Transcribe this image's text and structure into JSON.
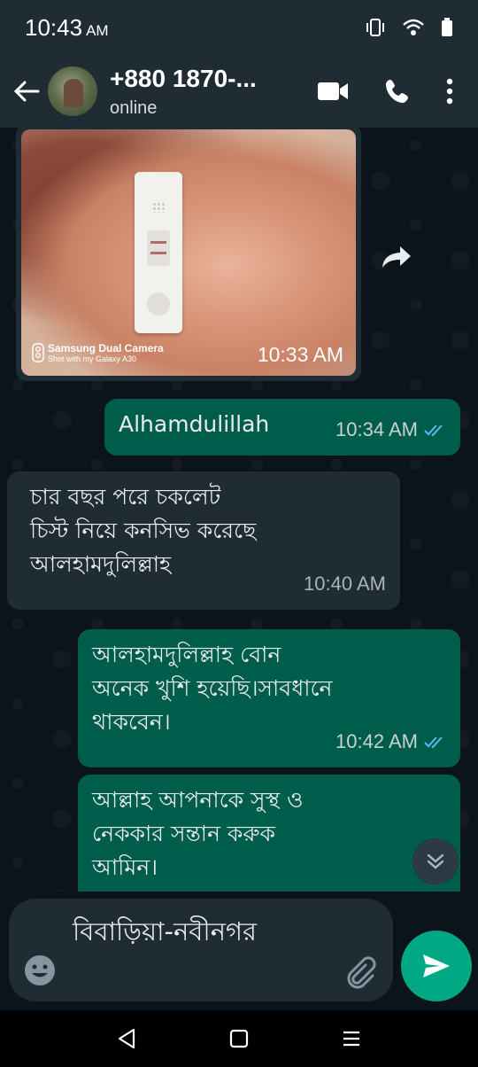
{
  "status_bar": {
    "time": "10:43",
    "ampm": "AM"
  },
  "header": {
    "contact_name": "+880 1870-...",
    "contact_status": "online"
  },
  "messages": {
    "image": {
      "camera_label": "Samsung Dual Camera",
      "camera_sub": "Shot with my Galaxy A30",
      "time": "10:33 AM"
    },
    "m1": {
      "text": "Alhamdulillah",
      "time": "10:34 AM"
    },
    "m2": {
      "line1": "চার বছর পরে চকলেট",
      "line2": "চিস্ট নিয়ে কনসিভ করেছে",
      "line3": "আলহামদুলিল্লাহ",
      "time": "10:40 AM"
    },
    "m3": {
      "line1": "আলহামদুলিল্লাহ বোন",
      "line2": "অনেক খুশি হয়েছি।সাবধানে",
      "line3": "থাকবেন।",
      "time": "10:42 AM"
    },
    "m4": {
      "line1": "আল্লাহ আপনাকে সুস্থ ও",
      "line2": "নেককার সন্তান করুক",
      "line3": "আমিন।"
    }
  },
  "composer": {
    "text": "বিবাড়িয়া-নবীনগর"
  },
  "colors": {
    "header": "#1f2c34",
    "outgoing": "#005c4b",
    "incoming": "#1f2c34",
    "send": "#00a884",
    "tick": "#53bdeb"
  },
  "icons": [
    "back-arrow-icon",
    "video-call-icon",
    "phone-icon",
    "more-vert-icon",
    "forward-icon",
    "read-ticks-icon",
    "chevron-double-down-icon",
    "emoji-icon",
    "attach-icon",
    "send-icon",
    "nav-back-icon",
    "nav-home-icon",
    "nav-menu-icon"
  ]
}
